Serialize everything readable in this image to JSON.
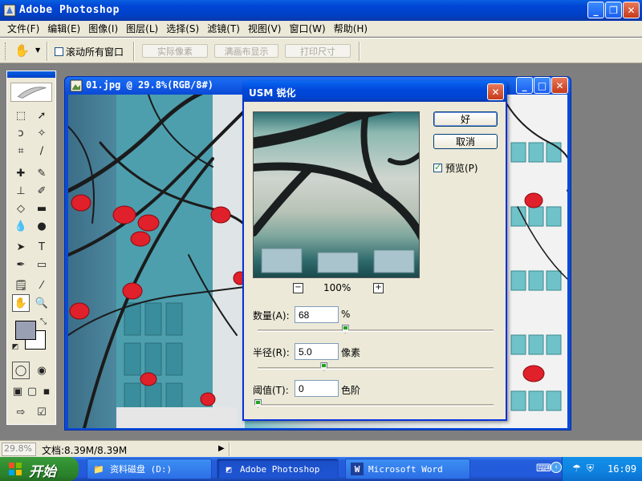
{
  "app": {
    "title": "Adobe Photoshop",
    "window_buttons": {
      "minimize": "_",
      "restore": "❐",
      "close": "✕"
    }
  },
  "menu": [
    "文件(F)",
    "编辑(E)",
    "图像(I)",
    "图层(L)",
    "选择(S)",
    "滤镜(T)",
    "视图(V)",
    "窗口(W)",
    "帮助(H)"
  ],
  "options_bar": {
    "scroll_all_windows_label": "滚动所有窗口",
    "scroll_all_windows_checked": false,
    "actual_pixels": "实际像素",
    "fit_on_screen": "满画布显示",
    "print_size": "打印尺寸"
  },
  "document": {
    "title": "01.jpg @ 29.8%(RGB/8#)"
  },
  "usm_dialog": {
    "title": "USM 锐化",
    "ok": "好",
    "cancel": "取消",
    "preview_label": "预览(P)",
    "preview_checked": true,
    "zoom_minus": "−",
    "zoom_plus": "+",
    "zoom_level": "100%",
    "amount_label": "数量(A):",
    "amount_value": "68",
    "amount_unit": "%",
    "amount_slider_fraction": 0.37,
    "radius_label": "半径(R):",
    "radius_value": "5.0",
    "radius_unit": "像素",
    "radius_slider_fraction": 0.28,
    "threshold_label": "阈值(T):",
    "threshold_value": "0",
    "threshold_unit": "色阶",
    "threshold_slider_fraction": 0.0
  },
  "status_bar": {
    "zoom": "29.8%",
    "doc_info": "文档:8.39M/8.39M"
  },
  "taskbar": {
    "start_label": "开始",
    "tasks": [
      {
        "label": "资料磁盘  (D:)",
        "icon": "folder-icon"
      },
      {
        "label": "Adobe Photoshop",
        "icon": "photoshop-icon"
      },
      {
        "label": "Microsoft Word",
        "icon": "word-icon"
      }
    ],
    "clock": "16:09"
  },
  "colors": {
    "foreground_swatch": "#9aa0b4",
    "background_swatch": "#ffffff",
    "xp_blue": "#0046d5",
    "start_green": "#2f8d2f"
  }
}
